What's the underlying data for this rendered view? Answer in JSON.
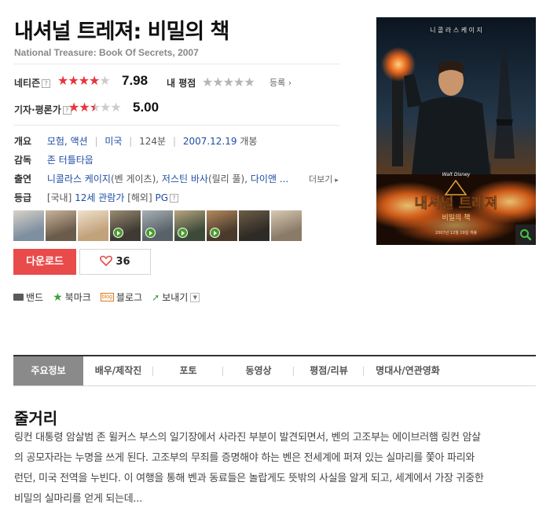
{
  "movie": {
    "title": "내셔널 트레져: 비밀의 책",
    "original_title": "National Treasure: Book Of Secrets, 2007"
  },
  "ratings": {
    "netizen_label": "네티즌",
    "netizen_score": "7.98",
    "netizen_stars": 4,
    "my_rating_label": "내 평점",
    "register_label": "등록",
    "critic_label": "기자·평론가",
    "critic_score": "5.00",
    "critic_stars": 2.5
  },
  "info": {
    "overview_label": "개요",
    "genres": [
      "모험",
      "액션"
    ],
    "country": "미국",
    "runtime": "124분",
    "release_date": "2007.12.19",
    "release_suffix": "개봉",
    "director_label": "감독",
    "director": "존 터틀타웁",
    "cast_label": "출연",
    "cast": [
      {
        "name": "니콜라스 케이지",
        "role": "(벤 게이츠)"
      },
      {
        "name": "저스틴 바사",
        "role": "(릴리 풀)"
      },
      {
        "name": "다이앤 ...",
        "role": ""
      }
    ],
    "more_label": "더보기",
    "grade_label": "등급",
    "grade_domestic_prefix": "[국내]",
    "grade_domestic": "12세 관람가",
    "grade_foreign_prefix": "[해외]",
    "grade_foreign": "PG"
  },
  "thumbnails": [
    {
      "video": false,
      "colors": [
        "#7d8fa0",
        "#d8d2c8"
      ]
    },
    {
      "video": false,
      "colors": [
        "#6b5b4a",
        "#c9b39a"
      ]
    },
    {
      "video": false,
      "colors": [
        "#c2a27b",
        "#efe1cc"
      ]
    },
    {
      "video": true,
      "colors": [
        "#3f3a33",
        "#9a8a72"
      ]
    },
    {
      "video": true,
      "colors": [
        "#5a6269",
        "#a7b0b4"
      ]
    },
    {
      "video": true,
      "colors": [
        "#3c4a3a",
        "#b8a680"
      ]
    },
    {
      "video": true,
      "colors": [
        "#4a3a2c",
        "#b48a5c"
      ]
    },
    {
      "video": false,
      "colors": [
        "#2e2a25",
        "#6d5d48"
      ]
    },
    {
      "video": false,
      "colors": [
        "#8a7a68",
        "#d7c9b3"
      ]
    }
  ],
  "actions": {
    "download_label": "다운로드",
    "like_count": "36"
  },
  "share": {
    "band": "밴드",
    "bookmark": "북마크",
    "blog_badge": "blog",
    "blog": "블로그",
    "send": "보내기"
  },
  "poster": {
    "top_text": "니 콜 라 스    케 이 지",
    "brand_text": "Walt Disney",
    "title_text": "내셔널 트레져",
    "subtitle_text": "비밀의 책",
    "bottom_text": "2007년 12월 19일 개봉",
    "colors": {
      "sky": "#1c2c3c",
      "fire": "#e2621b",
      "dark": "#0d0f12"
    }
  },
  "tabs": [
    {
      "label": "주요정보",
      "active": true
    },
    {
      "label": "배우/제작진",
      "active": false
    },
    {
      "label": "포토",
      "active": false
    },
    {
      "label": "동영상",
      "active": false
    },
    {
      "label": "평점/리뷰",
      "active": false
    },
    {
      "label": "명대사/연관영화",
      "active": false
    }
  ],
  "synopsis": {
    "heading": "줄거리",
    "lines": [
      "링컨 대통령 암살범 존 윌커스 부스의 일기장에서 사라진 부분이 발견되면서, 벤의 고조부는 에이브러햄 링컨 암살",
      "의 공모자라는 누명을 쓰게 된다. 고조부의 무죄를 증명해야 하는 벤은 전세계에 퍼져 있는 실마리를 쫓아 파리와",
      "런던, 미국 전역을 누빈다. 이 여행을 통해 벤과 동료들은 놀랍게도 뜻밖의 사실을 알게 되고, 세계에서 가장 귀중한",
      "비밀의 실마리를 얻게 되는데..."
    ]
  },
  "colors": {
    "accent": "#e94b4b",
    "link": "#1f4da5",
    "star_on": "#e8343d"
  }
}
